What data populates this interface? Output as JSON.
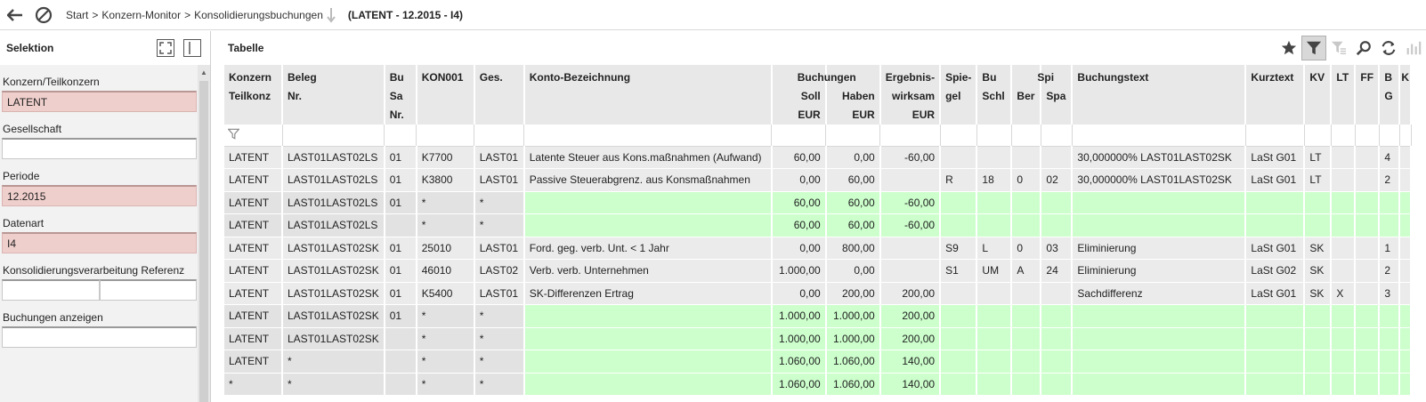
{
  "topbar": {
    "breadcrumb": [
      "Start",
      "Konzern-Monitor",
      "Konsolidierungsbuchungen"
    ],
    "separator": ">",
    "context": "(LATENT - 12.2015 - I4)"
  },
  "left": {
    "title": "Selektion",
    "fields": [
      {
        "label": "Konzern/Teilkonzern",
        "value": "LATENT",
        "highlight": true
      },
      {
        "label": "Gesellschaft",
        "value": "",
        "highlight": false
      },
      {
        "label": "Periode",
        "value": "12.2015",
        "highlight": true
      },
      {
        "label": "Datenart",
        "value": "I4",
        "highlight": true
      },
      {
        "label": "Konsolidierungsverarbeitung Referenz",
        "value": "",
        "value2": "",
        "split": true
      },
      {
        "label": "Buchungen anzeigen",
        "value": "",
        "highlight": false
      }
    ]
  },
  "right": {
    "title": "Tabelle"
  },
  "table": {
    "columns": [
      {
        "l1": "Konzern",
        "l2": "Teilkonz",
        "l3": "",
        "l4": ""
      },
      {
        "l1": "Beleg",
        "l2": "Nr.",
        "l3": "",
        "l4": ""
      },
      {
        "l1": "Bu",
        "l2": "Sa",
        "l3": "Nr.",
        "l4": ""
      },
      {
        "l1": "KON001",
        "l2": "",
        "l3": "",
        "l4": ""
      },
      {
        "l1": "Ges.",
        "l2": "",
        "l3": "",
        "l4": ""
      },
      {
        "l1": "Konto-Bezeichnung",
        "l2": "",
        "l3": "",
        "l4": ""
      },
      {
        "l1": "",
        "l2": "Soll",
        "l3": "EUR",
        "l4": ""
      },
      {
        "l1": "",
        "l2": "Haben",
        "l3": "EUR",
        "l4": ""
      },
      {
        "l1": "Ergebnis-",
        "l2": "wirksam",
        "l3": "EUR",
        "l4": ""
      },
      {
        "l1": "Spie-",
        "l2": "gel",
        "l3": "",
        "l4": ""
      },
      {
        "l1": "Bu",
        "l2": "Schl",
        "l3": "",
        "l4": ""
      },
      {
        "l1": "",
        "l2": "Ber",
        "l3": "",
        "l4": ""
      },
      {
        "l1": "",
        "l2": "Spa",
        "l3": "",
        "l4": ""
      },
      {
        "l1": "Buchungstext",
        "l2": "",
        "l3": "",
        "l4": ""
      },
      {
        "l1": "Kurztext",
        "l2": "",
        "l3": "",
        "l4": ""
      },
      {
        "l1": "KV",
        "l2": "",
        "l3": "",
        "l4": ""
      },
      {
        "l1": "LT",
        "l2": "",
        "l3": "",
        "l4": ""
      },
      {
        "l1": "FF",
        "l2": "",
        "l3": "",
        "l4": ""
      },
      {
        "l1": "B",
        "l2": "G",
        "l3": "",
        "l4": ""
      },
      {
        "l1": "K",
        "l2": "",
        "l3": "",
        "l4": ""
      }
    ],
    "group_buchungen": "Buchungen",
    "group_spi": "Spi",
    "rows": [
      {
        "type": "data",
        "cells": [
          "LATENT",
          "LAST01LAST02LS",
          "01",
          "K7700",
          "LAST01",
          "Latente Steuer aus Kons.maßnahmen (Aufwand)",
          "60,00",
          "0,00",
          "-60,00",
          "",
          "",
          "",
          "",
          "30,000000%  LAST01LAST02SK",
          "LaSt G01",
          "LT",
          "",
          "",
          "4",
          ""
        ]
      },
      {
        "type": "data",
        "cells": [
          "LATENT",
          "LAST01LAST02LS",
          "01",
          "K3800",
          "LAST01",
          "Passive Steuerabgrenz. aus Konsmaßnahmen",
          "0,00",
          "60,00",
          "",
          "R",
          "18",
          "0",
          "02",
          "30,000000%  LAST01LAST02SK",
          "LaSt G01",
          "LT",
          "",
          "",
          "2",
          ""
        ]
      },
      {
        "type": "sum",
        "cells": [
          "LATENT",
          "LAST01LAST02LS",
          "01",
          "*",
          "*",
          "",
          "60,00",
          "60,00",
          "-60,00",
          "",
          "",
          "",
          "",
          "",
          "",
          "",
          "",
          "",
          "",
          ""
        ]
      },
      {
        "type": "sum",
        "cells": [
          "LATENT",
          "LAST01LAST02LS",
          "",
          "*",
          "*",
          "",
          "60,00",
          "60,00",
          "-60,00",
          "",
          "",
          "",
          "",
          "",
          "",
          "",
          "",
          "",
          "",
          ""
        ]
      },
      {
        "type": "data",
        "cells": [
          "LATENT",
          "LAST01LAST02SK",
          "01",
          "25010",
          "LAST01",
          "Ford. geg. verb. Unt. < 1 Jahr",
          "0,00",
          "800,00",
          "",
          "S9",
          "L",
          "0",
          "03",
          "Eliminierung",
          "LaSt G01",
          "SK",
          "",
          "",
          "1",
          ""
        ]
      },
      {
        "type": "data",
        "cells": [
          "LATENT",
          "LAST01LAST02SK",
          "01",
          "46010",
          "LAST02",
          "Verb. verb. Unternehmen",
          "1.000,00",
          "0,00",
          "",
          "S1",
          "UM",
          "A",
          "24",
          "Eliminierung",
          "LaSt G02",
          "SK",
          "",
          "",
          "2",
          ""
        ]
      },
      {
        "type": "data",
        "cells": [
          "LATENT",
          "LAST01LAST02SK",
          "01",
          "K5400",
          "LAST01",
          "SK-Differenzen Ertrag",
          "0,00",
          "200,00",
          "200,00",
          "",
          "",
          "",
          "",
          "Sachdifferenz",
          "LaSt G01",
          "SK",
          "X",
          "",
          "3",
          ""
        ]
      },
      {
        "type": "sum",
        "cells": [
          "LATENT",
          "LAST01LAST02SK",
          "01",
          "*",
          "*",
          "",
          "1.000,00",
          "1.000,00",
          "200,00",
          "",
          "",
          "",
          "",
          "",
          "",
          "",
          "",
          "",
          "",
          ""
        ]
      },
      {
        "type": "sum",
        "cells": [
          "LATENT",
          "LAST01LAST02SK",
          "",
          "*",
          "*",
          "",
          "1.000,00",
          "1.000,00",
          "200,00",
          "",
          "",
          "",
          "",
          "",
          "",
          "",
          "",
          "",
          "",
          ""
        ]
      },
      {
        "type": "sum",
        "cells": [
          "LATENT",
          "*",
          "",
          "*",
          "*",
          "",
          "1.060,00",
          "1.060,00",
          "140,00",
          "",
          "",
          "",
          "",
          "",
          "",
          "",
          "",
          "",
          "",
          ""
        ]
      },
      {
        "type": "sum",
        "cells": [
          "*",
          "*",
          "",
          "*",
          "*",
          "",
          "1.060,00",
          "1.060,00",
          "140,00",
          "",
          "",
          "",
          "",
          "",
          "",
          "",
          "",
          "",
          "",
          ""
        ]
      }
    ]
  },
  "icons": {
    "back": "arrow-left-icon",
    "cancel": "ban-icon",
    "download": "download-arrow-icon",
    "favorite": "star-icon",
    "filter": "filter-icon",
    "filter_remove": "filter-clear-icon",
    "search": "magnifier-icon",
    "refresh": "refresh-icon",
    "chart": "bar-chart-icon"
  },
  "colors": {
    "highlight_field": "#efcfcc",
    "sum_green": "#ccffcc",
    "row_grey": "#ebebeb"
  }
}
